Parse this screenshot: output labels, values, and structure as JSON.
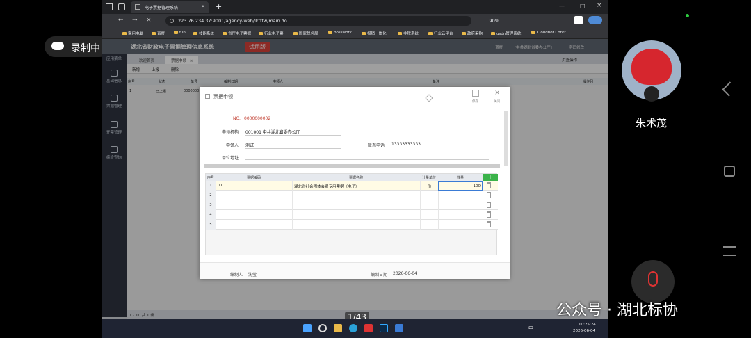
{
  "browser": {
    "tab_title": "电子票据管理系统",
    "url": "223.76.234.37:9001/agency-web/lkttfw/main.do",
    "zoom": "90%",
    "bookmarks": [
      "家用电脑",
      "百度",
      "fun",
      "技能系统",
      "省厅电子票据",
      "行业电子票",
      "国家税务局",
      "bosswork",
      "报销一体化",
      "非税系统",
      "行业云平台",
      "政府采购",
      "usdn管理系统",
      "Cloudbot Contr"
    ]
  },
  "app": {
    "system_title": "湖北省财政电子票据管理信息系统",
    "trial_badge": "试用版",
    "header_right": [
      "调度",
      "[中共湖北省委办公厅]",
      "密码修改"
    ],
    "nav": [
      "应用菜单",
      "基础信息",
      "票据管理",
      "开票管理",
      "综合查询"
    ],
    "tabs": [
      "欢迎首页",
      "票据申领"
    ],
    "tab_close": "×",
    "tab_ops": "页签操作",
    "toolbar": [
      "新增",
      "上报",
      "删除"
    ],
    "grid_headers": [
      "序号",
      "状态",
      "单号",
      "编制日期",
      "申领人",
      "备注",
      "操作列"
    ],
    "grid_row": {
      "no": "1",
      "status": "已上报",
      "doc": "0000000"
    },
    "pagination": "1 - 10  共 1 条"
  },
  "modal": {
    "title": "票据申领",
    "save": "保存",
    "close": "关闭",
    "no_label": "NO.",
    "no_value": "0000000002",
    "org_label": "申领机构",
    "org_value": "001001 中共湖北省委办公厅",
    "applicant_label": "申领人",
    "applicant_value": "测试",
    "phone_label": "联系电话",
    "phone_value": "13333333333",
    "address_label": "单位地址",
    "table_headers": [
      "序号",
      "票据编码",
      "票据名称",
      "计量单位",
      "数量"
    ],
    "add_btn": "+",
    "rows": [
      {
        "no": "1",
        "code": "01",
        "name": "湖北省社会团体会费专用票据（电子）",
        "unit": "份",
        "qty": "100"
      },
      {
        "no": "2",
        "code": "",
        "name": "",
        "unit": "",
        "qty": ""
      },
      {
        "no": "3",
        "code": "",
        "name": "",
        "unit": "",
        "qty": ""
      },
      {
        "no": "4",
        "code": "",
        "name": "",
        "unit": "",
        "qty": ""
      },
      {
        "no": "5",
        "code": "",
        "name": "",
        "unit": "",
        "qty": ""
      }
    ],
    "maker_label": "编制人",
    "maker_value": "沈莹",
    "date_label": "编制日期",
    "date_value": "2026-06-04"
  },
  "taskbar": {
    "time": "10:25:24",
    "date": "2026-06-04",
    "ime": "中"
  },
  "overlay": {
    "record_label": "录制中",
    "page_counter": "1/43",
    "user_name": "朱术茂",
    "watermark": "公众号 · 湖北标协"
  },
  "colors": {
    "accent": "#c0392b",
    "primary": "#3a7bd5",
    "add": "#3bb34a"
  }
}
